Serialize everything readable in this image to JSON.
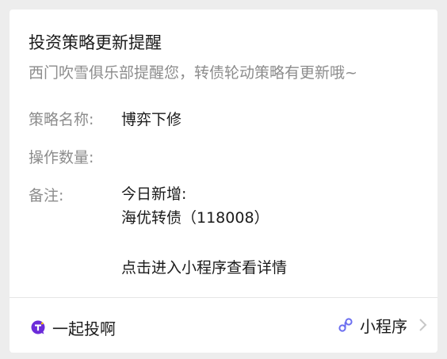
{
  "card": {
    "title": "投资策略更新提醒",
    "subtitle": "西门吹雪俱乐部提醒您，转债轮动策略有更新哦~",
    "fields": {
      "strategy_label": "策略名称:",
      "strategy_value": "博弈下修",
      "quantity_label": "操作数量:",
      "quantity_value": "",
      "note_label": "备注:",
      "note_line1": "今日新增:",
      "note_line2": "海优转债（118008）",
      "note_line3": "点击进入小程序查看详情"
    }
  },
  "footer": {
    "app_name": "一起投啊",
    "mini_program_label": "小程序",
    "icons": {
      "app_logo": "app-logo-icon",
      "mini_program": "mini-program-link-icon",
      "chevron": "chevron-right-icon"
    }
  },
  "colors": {
    "background": "#ededed",
    "card": "#ffffff",
    "primary_text": "#1a1a1a",
    "secondary_text": "#8c8c8c",
    "logo_purple": "#6b2bd9",
    "link_icon": "#6c6ff0",
    "chevron": "#c7c7c7"
  }
}
